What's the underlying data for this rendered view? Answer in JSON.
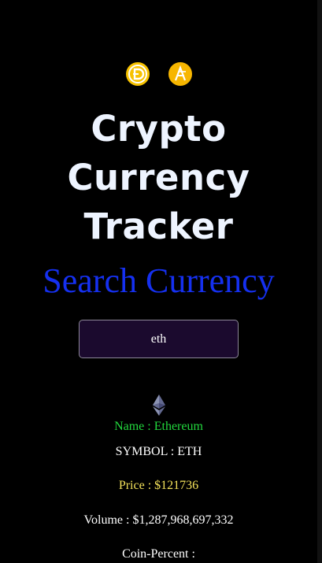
{
  "header": {
    "icons": [
      "dogecoin-icon",
      "ankr-icon"
    ],
    "title_lines": [
      "Crypto",
      "Currency",
      "Tracker"
    ],
    "subtitle": "Search Currency"
  },
  "search": {
    "value": "eth"
  },
  "result": {
    "logo": "ethereum-icon",
    "name": "Name : Ethereum",
    "symbol": "SYMBOL : ETH",
    "price": "Price : $121736",
    "volume": "Volume : $1,287,968,697,332",
    "coin_percent": "Coin-Percent :"
  },
  "colors": {
    "background": "#000000",
    "title": "#eef4ff",
    "subtitle": "#1530f0",
    "name": "#22d83d",
    "price": "#f4e25a",
    "search_bg": "#1b0a2e"
  }
}
